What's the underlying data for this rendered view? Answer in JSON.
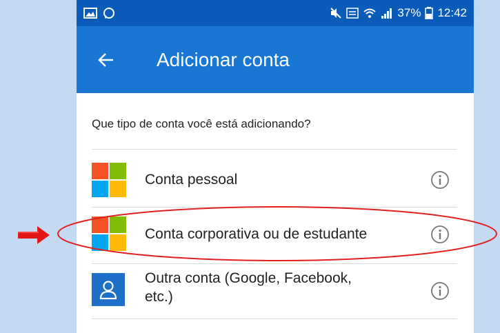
{
  "status_bar": {
    "battery": "37%",
    "time": "12:42"
  },
  "app_bar": {
    "title": "Adicionar conta"
  },
  "prompt": "Que tipo de conta você está adicionando?",
  "accounts": [
    {
      "label": "Conta pessoal",
      "icon": "microsoft-logo-icon"
    },
    {
      "label": "Conta corporativa ou de estudante",
      "icon": "microsoft-logo-icon"
    },
    {
      "label_line1": "Outra conta (Google, Facebook,",
      "label_line2": "etc.)",
      "icon": "person-icon"
    }
  ],
  "colors": {
    "status_bar": "#0a5cb8",
    "app_bar": "#1976d2",
    "background": "#c4daf3",
    "ms_red": "#f35325",
    "ms_green": "#81bc06",
    "ms_blue": "#05a6f0",
    "ms_yellow": "#ffba08",
    "highlight": "#e02020"
  }
}
